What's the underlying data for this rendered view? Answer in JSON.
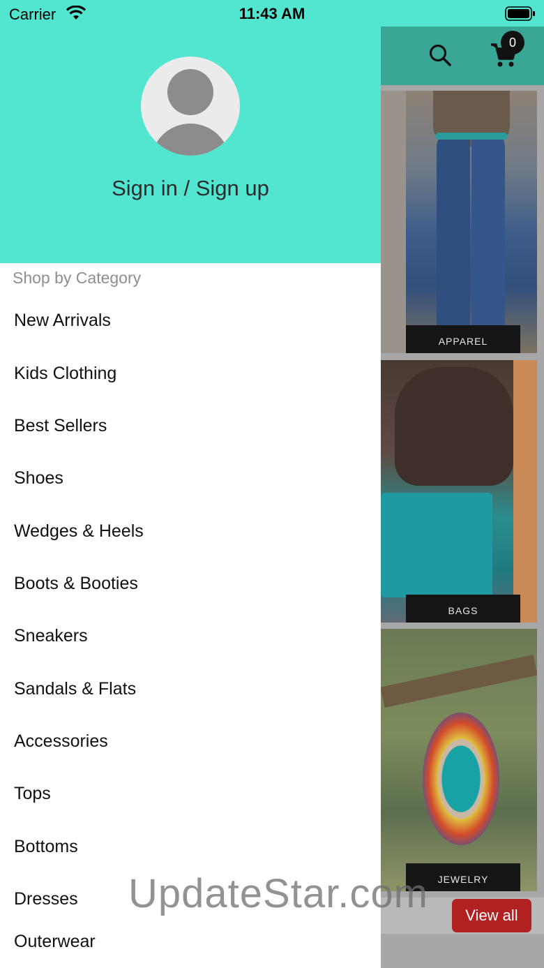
{
  "status_bar": {
    "carrier": "Carrier",
    "time": "11:43 AM"
  },
  "drawer": {
    "sign_in_label": "Sign in / Sign up",
    "section_title": "Shop by Category",
    "categories": [
      "New Arrivals",
      "Kids Clothing",
      "Best Sellers",
      "Shoes",
      "Wedges & Heels",
      "Boots & Booties",
      "Sneakers",
      "Sandals & Flats",
      "Accessories",
      "Tops",
      "Bottoms",
      "Dresses",
      "Outerwear"
    ]
  },
  "app_header": {
    "cart_count": "0"
  },
  "tiles": [
    {
      "label": "APPAREL"
    },
    {
      "label": "BAGS"
    },
    {
      "label": "JEWELRY"
    }
  ],
  "view_all_label": "View all",
  "watermark": "UpdateStar.com",
  "colors": {
    "header_teal": "#52e5cf",
    "dim_teal": "#3aa796",
    "view_all_red": "#b12121"
  }
}
